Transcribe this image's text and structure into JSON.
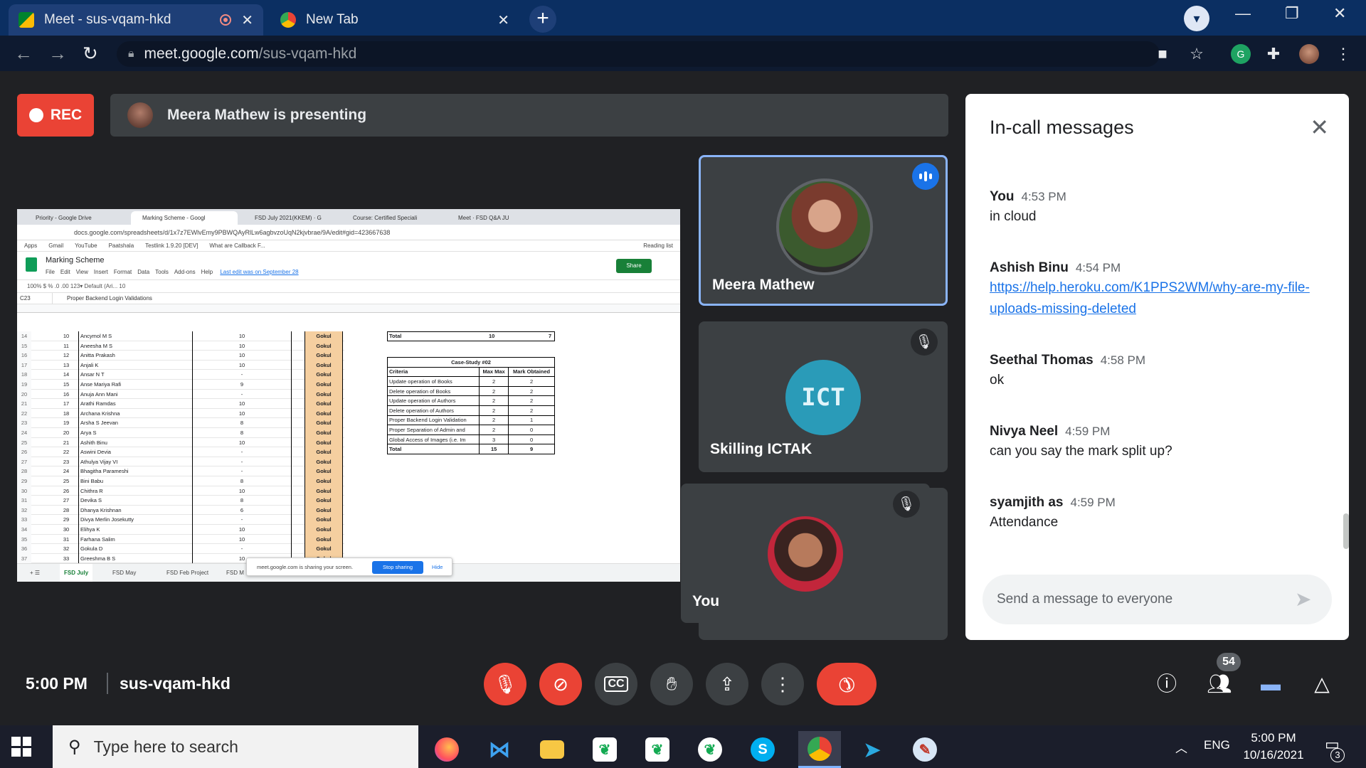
{
  "browser": {
    "tabs": [
      {
        "title": "Meet - sus-vqam-hkd",
        "close": "✕"
      },
      {
        "title": "New Tab",
        "close": "✕"
      }
    ],
    "new_tab": "+",
    "url_host": "meet.google.com",
    "url_path": "/sus-vqam-hkd"
  },
  "meet": {
    "rec_label": "REC",
    "presenting_text": "Meera Mathew is presenting",
    "meeting_time": "5:00 PM",
    "meeting_code": "sus-vqam-hkd",
    "participant_count": "54",
    "participants": [
      {
        "name": "Meera Mathew",
        "speaking": true
      },
      {
        "name": "Skilling ICTAK",
        "muted": true
      },
      {
        "name": "You",
        "muted": true
      }
    ]
  },
  "shared_screen": {
    "tabs": [
      "Priority - Google Drive",
      "Marking Scheme - Googl",
      "FSD July 2021(KKEM) · G",
      "Course: Certified Speciali",
      "Meet · FSD Q&A JU"
    ],
    "url": "docs.google.com/spreadsheets/d/1x7z7EWlvEmy9PBWQAyRlLw6agbvzoUqN2kjvbrae/9A/edit#gid=423667638",
    "bookmarks": [
      "Apps",
      "Gmail",
      "YouTube",
      "Paatshala",
      "Testlink 1.9.20 [DEV]",
      "What are Callback F...",
      "Reading list"
    ],
    "doc_title": "Marking Scheme",
    "menu": [
      "File",
      "Edit",
      "View",
      "Insert",
      "Format",
      "Data",
      "Tools",
      "Add-ons",
      "Help"
    ],
    "last_edit": "Last edit was on September 28",
    "share_btn": "Share",
    "tools_text": "100%   $   %   .0  .00  123▾   Default (Ari...   10",
    "cell_ref": "C23",
    "formula": "Proper Backend Login Validations",
    "rows": [
      {
        "rn": "14",
        "no": "10",
        "name": "Ancymol M S",
        "mark": "10",
        "eval": "Gokul"
      },
      {
        "rn": "15",
        "no": "11",
        "name": "Aneesha M S",
        "mark": "10",
        "eval": "Gokul"
      },
      {
        "rn": "16",
        "no": "12",
        "name": "Anitta Prakash",
        "mark": "10",
        "eval": "Gokul"
      },
      {
        "rn": "17",
        "no": "13",
        "name": "Anjali K",
        "mark": "10",
        "eval": "Gokul"
      },
      {
        "rn": "18",
        "no": "14",
        "name": "Ansar N T",
        "mark": "-",
        "eval": "Gokul"
      },
      {
        "rn": "19",
        "no": "15",
        "name": "Anse Mariya Rafi",
        "mark": "9",
        "eval": "Gokul"
      },
      {
        "rn": "20",
        "no": "16",
        "name": "Anuja Ann Mani",
        "mark": "-",
        "eval": "Gokul"
      },
      {
        "rn": "21",
        "no": "17",
        "name": "Arathi Ramdas",
        "mark": "10",
        "eval": "Gokul"
      },
      {
        "rn": "22",
        "no": "18",
        "name": "Archana Krishna",
        "mark": "10",
        "eval": "Gokul"
      },
      {
        "rn": "23",
        "no": "19",
        "name": "Arsha S Jeevan",
        "mark": "8",
        "eval": "Gokul"
      },
      {
        "rn": "24",
        "no": "20",
        "name": "Arya S",
        "mark": "8",
        "eval": "Gokul"
      },
      {
        "rn": "25",
        "no": "21",
        "name": "Ashith Binu",
        "mark": "10",
        "eval": "Gokul"
      },
      {
        "rn": "26",
        "no": "22",
        "name": "Aswini Devia",
        "mark": "-",
        "eval": "Gokul"
      },
      {
        "rn": "27",
        "no": "23",
        "name": "Athulya Vijay VI",
        "mark": "-",
        "eval": "Gokul"
      },
      {
        "rn": "28",
        "no": "24",
        "name": "Bhagitha Parameshi",
        "mark": "-",
        "eval": "Gokul"
      },
      {
        "rn": "29",
        "no": "25",
        "name": "Bini Babu",
        "mark": "8",
        "eval": "Gokul"
      },
      {
        "rn": "30",
        "no": "26",
        "name": "Chithra R",
        "mark": "10",
        "eval": "Gokul"
      },
      {
        "rn": "31",
        "no": "27",
        "name": "Devika S",
        "mark": "8",
        "eval": "Gokul"
      },
      {
        "rn": "32",
        "no": "28",
        "name": "Dhanya Krishnan",
        "mark": "6",
        "eval": "Gokul"
      },
      {
        "rn": "33",
        "no": "29",
        "name": "Divya Merlin Josekutty",
        "mark": "-",
        "eval": "Gokul"
      },
      {
        "rn": "34",
        "no": "30",
        "name": "Elihya K",
        "mark": "10",
        "eval": "Gokul"
      },
      {
        "rn": "35",
        "no": "31",
        "name": "Farhana Salim",
        "mark": "10",
        "eval": "Gokul"
      },
      {
        "rn": "36",
        "no": "32",
        "name": "Gokula D",
        "mark": "-",
        "eval": "Gokul"
      },
      {
        "rn": "37",
        "no": "33",
        "name": "Greeshma B S",
        "mark": "10",
        "eval": "Gokul"
      }
    ],
    "total_label": "Total",
    "total_max": "10",
    "total_got": "7",
    "case_study": {
      "title": "Case-Study #02",
      "headers": [
        "Criteria",
        "Max Max",
        "Mark Obtained"
      ],
      "rows": [
        [
          "Update operation of Books",
          "2",
          "2"
        ],
        [
          "Delete operation of Books",
          "2",
          "2"
        ],
        [
          "Update operation of Authors",
          "2",
          "2"
        ],
        [
          "Delete operation of Authors",
          "2",
          "2"
        ],
        [
          "Proper Backend Login Validation",
          "2",
          "1"
        ],
        [
          "Proper Separation of Admin and",
          "2",
          "0"
        ],
        [
          "Global Access of Images (i.e. Im",
          "3",
          "0"
        ],
        [
          "Total",
          "15",
          "9"
        ]
      ]
    },
    "sheets": [
      "FSD July",
      "FSD May",
      "FSD Feb Project",
      "FSD M"
    ],
    "share_msg": "meet.google.com is sharing your screen.",
    "stop_sharing": "Stop sharing",
    "hide": "Hide"
  },
  "chat": {
    "title": "In-call messages",
    "messages": [
      {
        "sender": "You",
        "time": "4:53 PM",
        "text": "in cloud"
      },
      {
        "sender": "Ashish Binu",
        "time": "4:54 PM",
        "text": "https://help.heroku.com/K1PPS2WM/why-are-my-file-uploads-missing-deleted"
      },
      {
        "sender": "Seethal Thomas",
        "time": "4:58 PM",
        "text": "ok"
      },
      {
        "sender": "Nivya Neel",
        "time": "4:59 PM",
        "text": "can you say the mark split up?"
      },
      {
        "sender": "syamjith as",
        "time": "4:59 PM",
        "text": "Attendance"
      }
    ],
    "input_placeholder": "Send a message to everyone"
  },
  "taskbar": {
    "search_placeholder": "Type here to search",
    "lang": "ENG",
    "time": "5:00 PM",
    "date": "10/16/2021",
    "notif_count": "3"
  },
  "colors": {
    "meet_bg": "#202124",
    "tile_bg": "#3c4043",
    "danger": "#ea4335",
    "accent": "#1a73e8",
    "tab_strip": "#0b2f62"
  }
}
